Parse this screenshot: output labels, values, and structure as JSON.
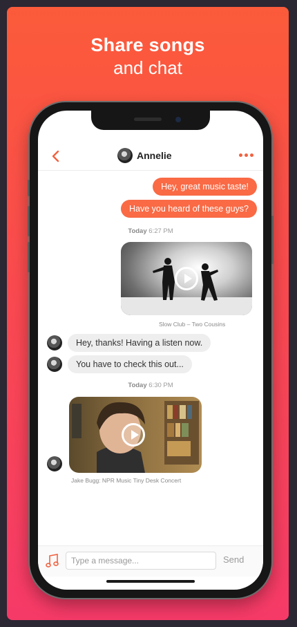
{
  "headline": {
    "line1": "Share songs",
    "line2": "and chat"
  },
  "conversation": {
    "contact_name": "Annelie"
  },
  "messages": {
    "out1": "Hey, great music taste!",
    "out2": "Have you heard of these guys?",
    "stamp1_day": "Today",
    "stamp1_time": "6:27 PM",
    "video1_caption": "Slow Club – Two Cousins",
    "in1": "Hey, thanks! Having a listen now.",
    "in2": "You have to check this out...",
    "stamp2_day": "Today",
    "stamp2_time": "6:30 PM",
    "video2_caption": "Jake Bugg: NPR Music Tiny Desk Concert"
  },
  "composer": {
    "placeholder": "Type a message...",
    "send_label": "Send"
  },
  "icons": {
    "back": "chevron-left-icon",
    "more": "more-horizontal-icon",
    "music": "music-note-icon",
    "play": "play-icon"
  },
  "colors": {
    "accent": "#f96a45",
    "gradient_top": "#fb5b3a",
    "gradient_bottom": "#f63a68"
  }
}
